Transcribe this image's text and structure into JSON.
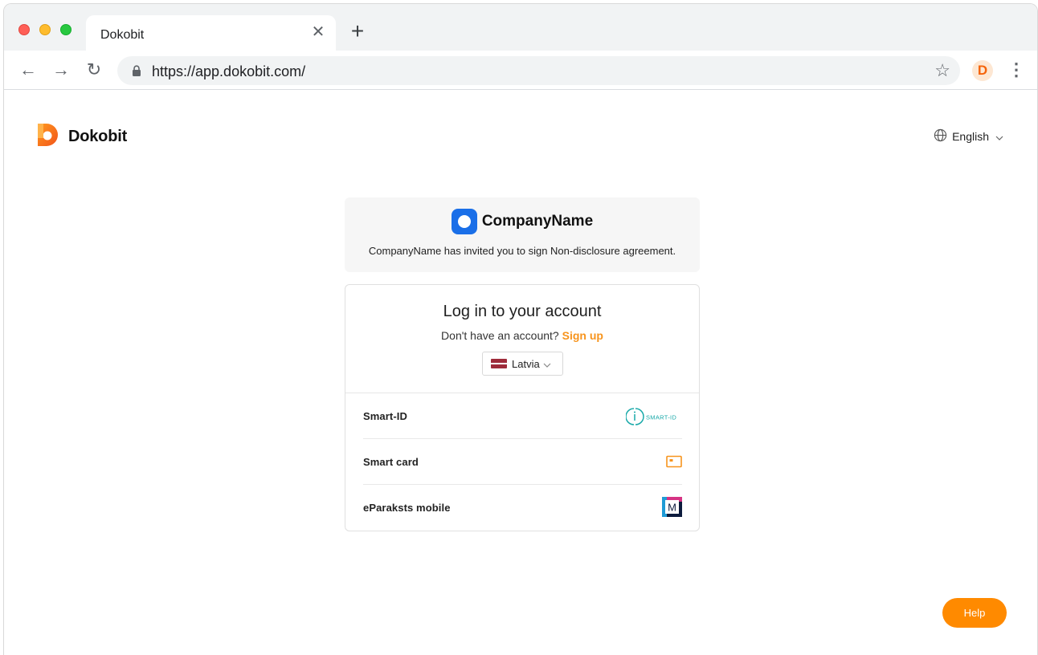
{
  "browser": {
    "tab": {
      "title": "Dokobit",
      "close_glyph": "✕"
    },
    "new_tab_glyph": "+",
    "toolbar": {
      "back_glyph": "←",
      "forward_glyph": "→",
      "reload_glyph": "↻",
      "url": "https://app.dokobit.com/",
      "bookmark_glyph": "☆",
      "profile_letter": "D",
      "menu_glyph": "⋮"
    }
  },
  "header": {
    "brand_name": "Dokobit",
    "language": "English"
  },
  "invite": {
    "company_name": "CompanyName",
    "message": "CompanyName has invited you to sign Non-disclosure agreement."
  },
  "login": {
    "title": "Log in to your account",
    "no_account_text": "Don't have an account?",
    "signup_link": "Sign up",
    "country": "Latvia",
    "methods": [
      {
        "label": "Smart-ID",
        "icon": "smart-id-logo",
        "logo_text": "SMART-ID"
      },
      {
        "label": "Smart card",
        "icon": "smart-card-icon"
      },
      {
        "label": "eParaksts mobile",
        "icon": "eparaksts-mobile-logo",
        "logo_text": "M"
      }
    ]
  },
  "help_button": "Help",
  "colors": {
    "accent": "#f7941d",
    "help_button": "#ff8a00",
    "company_logo": "#1a6fe8",
    "smart_id": "#19a9a9"
  }
}
